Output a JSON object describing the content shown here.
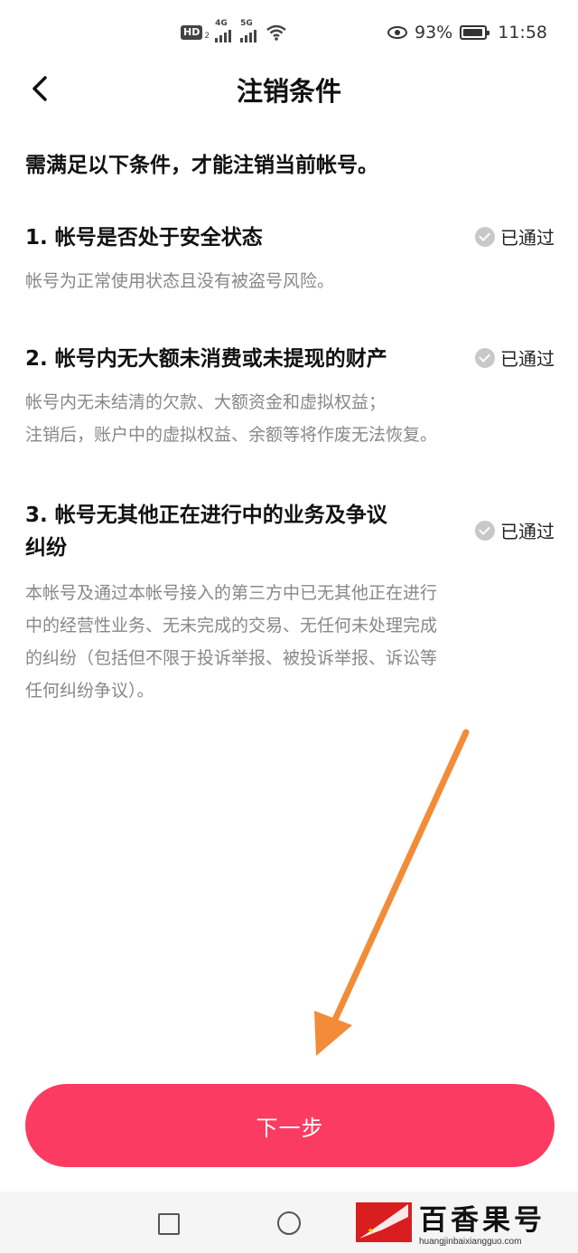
{
  "status_bar": {
    "hd_label": "HD",
    "hd_sub": "2",
    "signal1_tag": "4G",
    "signal2_tag": "5G",
    "battery_percent": "93%",
    "battery_level": 0.93,
    "time": "11:58"
  },
  "header": {
    "title": "注销条件"
  },
  "intro": "需满足以下条件，才能注销当前帐号。",
  "conditions": [
    {
      "title": "1. 帐号是否处于安全状态",
      "status": "已通过",
      "desc": "帐号为正常使用状态且没有被盗号风险。"
    },
    {
      "title": "2. 帐号内无大额未消费或未提现的财产",
      "status": "已通过",
      "desc_line1": "帐号内无未结清的欠款、大额资金和虚拟权益；",
      "desc_line2": "注销后，账户中的虚拟权益、余额等将作废无法恢复。"
    },
    {
      "title_line1": "3. 帐号无其他正在进行中的业务及争议",
      "title_line2": "纠纷",
      "status": "已通过",
      "desc_line1": "本帐号及通过本帐号接入的第三方中已无其他正在进行",
      "desc_line2": "中的经营性业务、无未完成的交易、无任何未处理完成",
      "desc_line3": "的纠纷（包括但不限于投诉举报、被投诉举报、诉讼等",
      "desc_line4": "任何纠纷争议）。"
    }
  ],
  "next_button": "下一步",
  "watermark": {
    "name": "百香果号",
    "url": "huangjinbaixiangguo.com"
  },
  "colors": {
    "accent": "#fb3b62",
    "arrow": "#f28c38",
    "check": "#c8c8c8"
  },
  "icons": [
    "back-arrow-icon",
    "check-circle-icon",
    "nav-recents-icon",
    "nav-home-icon",
    "eye-icon",
    "battery-icon",
    "wifi-icon",
    "signal-icon"
  ]
}
